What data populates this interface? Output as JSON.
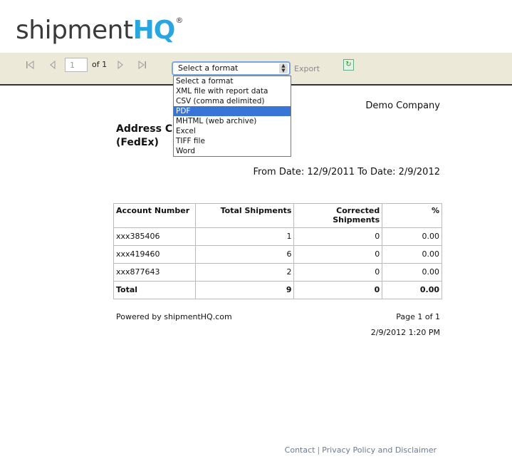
{
  "logo": {
    "part1": "shipment",
    "part2": "HQ",
    "reg": "®",
    "colors": {
      "text": "#3a3a3a",
      "accent": "#29a6df"
    }
  },
  "toolbar": {
    "first_icon": "first-page-icon",
    "prev_icon": "prev-page-icon",
    "next_icon": "next-page-icon",
    "last_icon": "last-page-icon",
    "page_value": "1",
    "page_of": "of 1",
    "format_selected": "Select a format",
    "export_label": "Export",
    "refresh_icon": "refresh-icon"
  },
  "dropdown": {
    "options": [
      "Select a format",
      "XML file with report data",
      "CSV (comma delimited)",
      "PDF",
      "MHTML (web archive)",
      "Excel",
      "TIFF file",
      "Word"
    ],
    "highlighted": "PDF",
    "highlight_color": "#3875d7"
  },
  "report": {
    "company": "Demo Company",
    "title_line1": "Address C",
    "title_line2": "(FedEx)",
    "date_range": "From Date: 12/9/2011 To Date: 2/9/2012",
    "columns": [
      "Account Number",
      "Total Shipments",
      "Corrected Shipments",
      "%"
    ],
    "rows": [
      [
        "xxx385406",
        "1",
        "0",
        "0.00"
      ],
      [
        "xxx419460",
        "6",
        "0",
        "0.00"
      ],
      [
        "xxx877643",
        "2",
        "0",
        "0.00"
      ]
    ],
    "total": [
      "Total",
      "9",
      "0",
      "0.00"
    ],
    "powered_by": "Powered by shipmentHQ.com",
    "page_info": "Page 1 of 1",
    "printed_at": "2/9/2012 1:20 PM"
  },
  "footer": {
    "contact": "Contact",
    "separator": "|",
    "privacy": "Privacy Policy and Disclaimer"
  }
}
